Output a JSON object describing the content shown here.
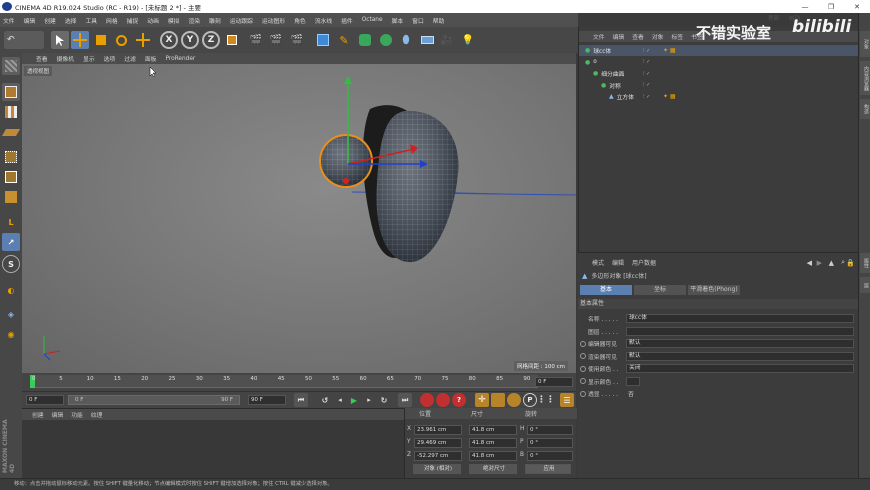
{
  "window": {
    "title": "CINEMA 4D R19.024 Studio (RC - R19) - [未标题 2 *] - 主要",
    "controls": [
      "—",
      "❐",
      "✕"
    ]
  },
  "menubar": [
    "文件",
    "编辑",
    "创建",
    "选择",
    "工具",
    "网格",
    "捕捉",
    "动画",
    "模拟",
    "渲染",
    "雕刻",
    "运动跟踪",
    "运动图形",
    "角色",
    "流水线",
    "插件",
    "Octane",
    "脚本",
    "窗口",
    "帮助"
  ],
  "layout_tabs": [
    "界面",
    "启动"
  ],
  "watermark": {
    "text": "不错实验室",
    "logo": "bilibili"
  },
  "viewport": {
    "menu": [
      "查看",
      "摄像机",
      "显示",
      "选项",
      "过滤",
      "面板",
      "ProRender"
    ],
    "label": "透视视图",
    "grid_label": "网格间距 : 100 cm"
  },
  "timeline": {
    "ticks": [
      "0",
      "5",
      "10",
      "15",
      "20",
      "25",
      "30",
      "35",
      "40",
      "45",
      "50",
      "55",
      "60",
      "65",
      "70",
      "75",
      "80",
      "85",
      "90"
    ],
    "current_frame": "0 F",
    "start": "0 F",
    "end": "90 F",
    "range_end": "90 F",
    "range_field": "0 F"
  },
  "material_manager": {
    "menu": [
      "创建",
      "编辑",
      "功能",
      "纹理"
    ]
  },
  "coordinates": {
    "headers": [
      "位置",
      "尺寸",
      "旋转"
    ],
    "rows": [
      {
        "axis": "X",
        "pos": "23.961 cm",
        "size": "41.8 cm",
        "rot_axis": "H",
        "rot": "0 °"
      },
      {
        "axis": "Y",
        "pos": "29.469 cm",
        "size": "41.8 cm",
        "rot_axis": "P",
        "rot": "0 °"
      },
      {
        "axis": "Z",
        "pos": "-52.297 cm",
        "size": "41.8 cm",
        "rot_axis": "B",
        "rot": "0 °"
      }
    ],
    "mode_object": "对象 (相对)",
    "mode_size": "绝对尺寸",
    "apply": "应用"
  },
  "object_manager": {
    "menu": [
      "文件",
      "编辑",
      "查看",
      "对象",
      "标签",
      "书签"
    ],
    "objects": [
      {
        "name": "球cc体",
        "indent": 0,
        "selected": true
      },
      {
        "name": "o",
        "indent": 0,
        "selected": false
      },
      {
        "name": "细分曲面",
        "indent": 1,
        "selected": false
      },
      {
        "name": "对称",
        "indent": 2,
        "selected": false
      },
      {
        "name": "立方体",
        "indent": 3,
        "selected": false
      }
    ]
  },
  "attribute_manager": {
    "menu": [
      "模式",
      "编辑",
      "用户数据"
    ],
    "object_title": "多边形对象 [球cc体]",
    "tabs": [
      "基本",
      "坐标",
      "平滑着色(Phong)"
    ],
    "section": "基本属性",
    "fields": [
      {
        "label": "名称 . . . . .",
        "value": "球cc体"
      },
      {
        "label": "图层 . . . . .",
        "value": ""
      },
      {
        "label": "编辑器可见",
        "value": "默认"
      },
      {
        "label": "渲染器可见",
        "value": "默认"
      },
      {
        "label": "使用颜色 . .",
        "value": "关闭"
      },
      {
        "label": "显示颜色 . .",
        "value": ""
      },
      {
        "label": "透显 . . . . .",
        "value": "否"
      }
    ]
  },
  "right_tabs": [
    "对象",
    "内容浏览器",
    "构造",
    "属性",
    "层"
  ],
  "statusbar": "移动：点击并拖动鼠标移动元素。按住 SHIFT 键量化移动；节点编辑模式时按住 SHIFT 键增加选择对象；按住 CTRL 键减少选择对象。",
  "brand": "MAXON CINEMA 4D"
}
